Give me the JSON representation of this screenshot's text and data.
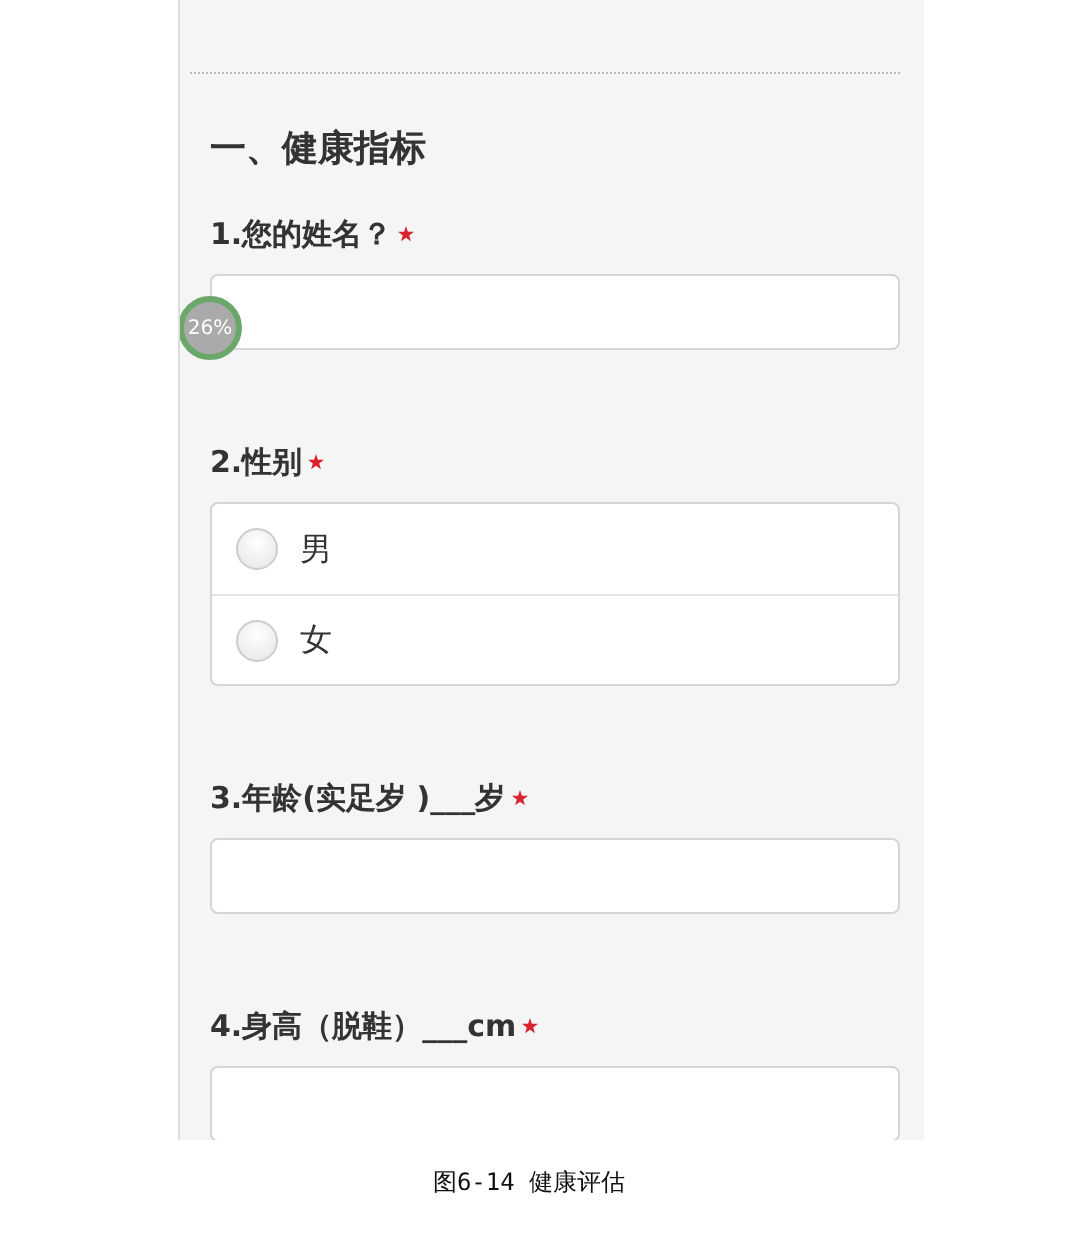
{
  "section": {
    "title": "一、健康指标"
  },
  "progress_badge": {
    "text": "26%"
  },
  "questions": [
    {
      "kind": "text",
      "label": "1.您的姓名？",
      "required": true
    },
    {
      "kind": "radio",
      "label": "2.性别",
      "required": true,
      "options": [
        {
          "label": "男",
          "selected": false
        },
        {
          "label": "女",
          "selected": false
        }
      ]
    },
    {
      "kind": "text",
      "label": "3.年龄(实足岁 )___岁",
      "required": true
    },
    {
      "kind": "text",
      "label": "4.身高（脱鞋）___cm",
      "required": true
    }
  ],
  "caption": "图6-14 健康评估"
}
